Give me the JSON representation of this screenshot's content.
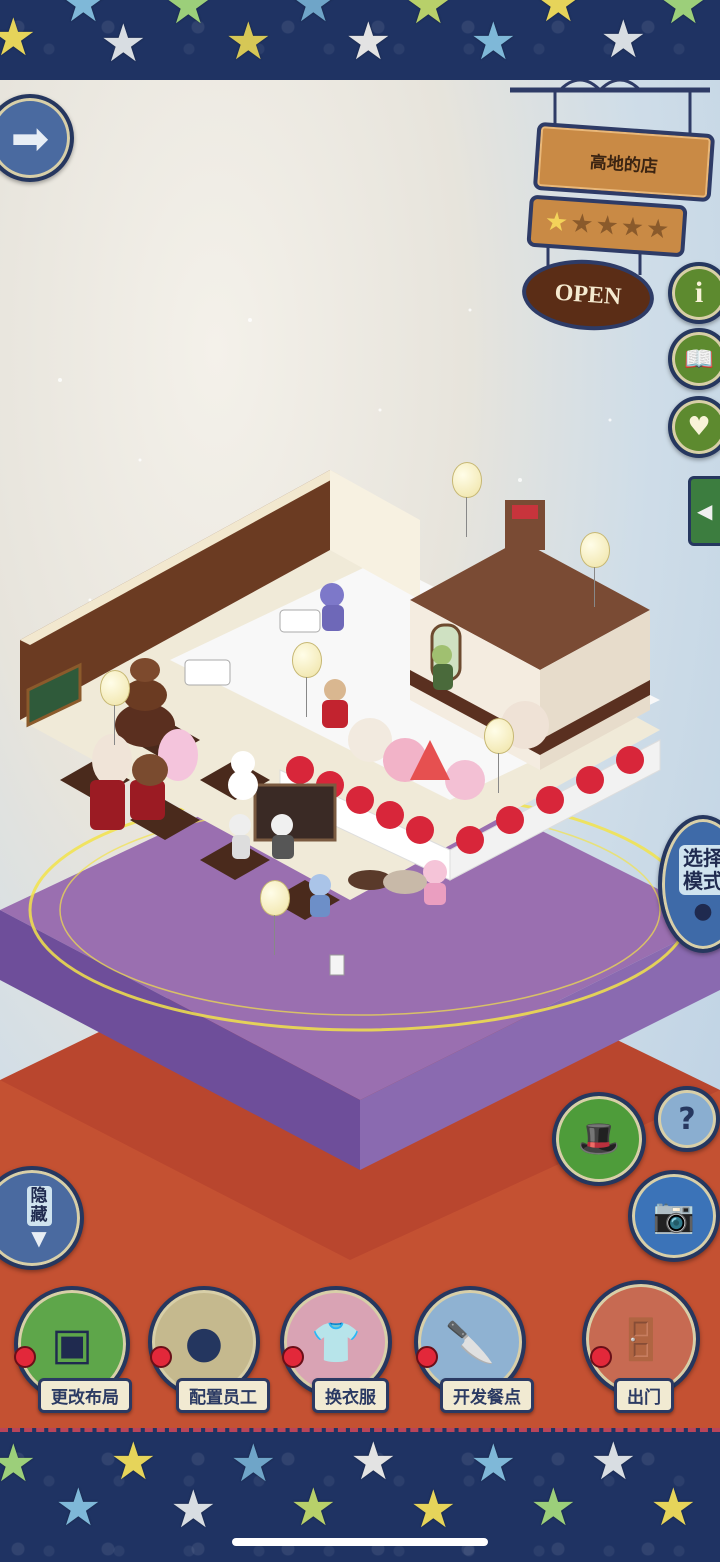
{
  "shop": {
    "name": "高地的店",
    "open_label": "OPEN",
    "rating_stars_filled": 1,
    "rating_stars_total": 5
  },
  "side_buttons": {
    "mode_label": "选择\n模式",
    "hide_label": "隐\n藏",
    "help_label": "?"
  },
  "bottom_menu": {
    "layout_label": "更改布局",
    "staff_label": "配置员工",
    "outfit_label": "换衣服",
    "menu_label": "开发餐点",
    "exit_label": "出门"
  },
  "colors": {
    "band": "#1f3363",
    "accent_red": "#e2283a",
    "sign_wood": "#c98a45",
    "open_sign": "#5b2d16"
  }
}
